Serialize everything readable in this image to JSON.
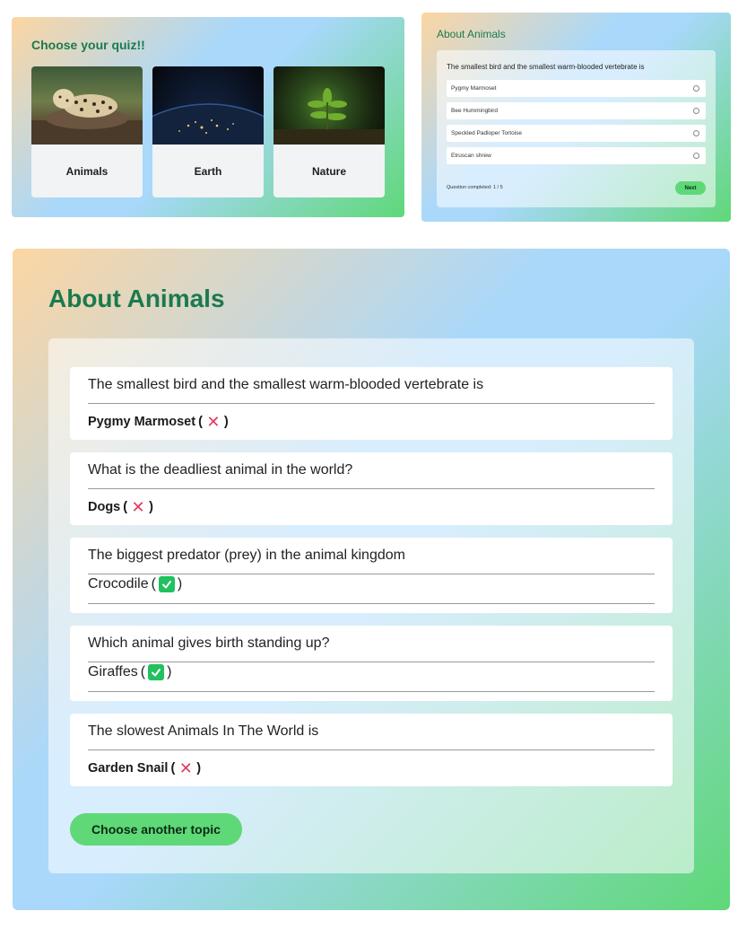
{
  "choose": {
    "title": "Choose your quiz!!",
    "cards": [
      {
        "label": "Animals"
      },
      {
        "label": "Earth"
      },
      {
        "label": "Nature"
      }
    ]
  },
  "quiz": {
    "title": "About Animals",
    "question": "The smallest bird and the smallest warm-blooded vertebrate is",
    "options": [
      "Pygmy Marmoset",
      "Bee Hummingbird",
      "Speckled Padloper Tortoise",
      "Etruscan shrew"
    ],
    "progress": "Question completed: 1 / 5",
    "next_label": "Next"
  },
  "results": {
    "title": "About Animals",
    "items": [
      {
        "question": "The smallest bird and the smallest warm-blooded vertebrate is",
        "answer": "Pygmy Marmoset",
        "open": "(",
        "close": ")",
        "correct": false
      },
      {
        "question": "What is the deadliest animal in the world?",
        "answer": "Dogs",
        "open": "(",
        "close": ")",
        "correct": false
      },
      {
        "question": "The biggest predator (prey) in the animal kingdom",
        "answer": "Crocodile",
        "open": "(",
        "close": ")",
        "correct": true
      },
      {
        "question": "Which animal gives birth standing up?",
        "answer": "Giraffes",
        "open": "(",
        "close": ")",
        "correct": true
      },
      {
        "question": "The slowest Animals In The World is",
        "answer": "Garden Snail",
        "open": "(",
        "close": ")",
        "correct": false
      }
    ],
    "another_label": "Choose another topic"
  },
  "colors": {
    "accent_green": "#5fd878",
    "title_green": "#1a7a4f",
    "wrong_red": "#e23a5b",
    "right_green": "#21c15f"
  }
}
